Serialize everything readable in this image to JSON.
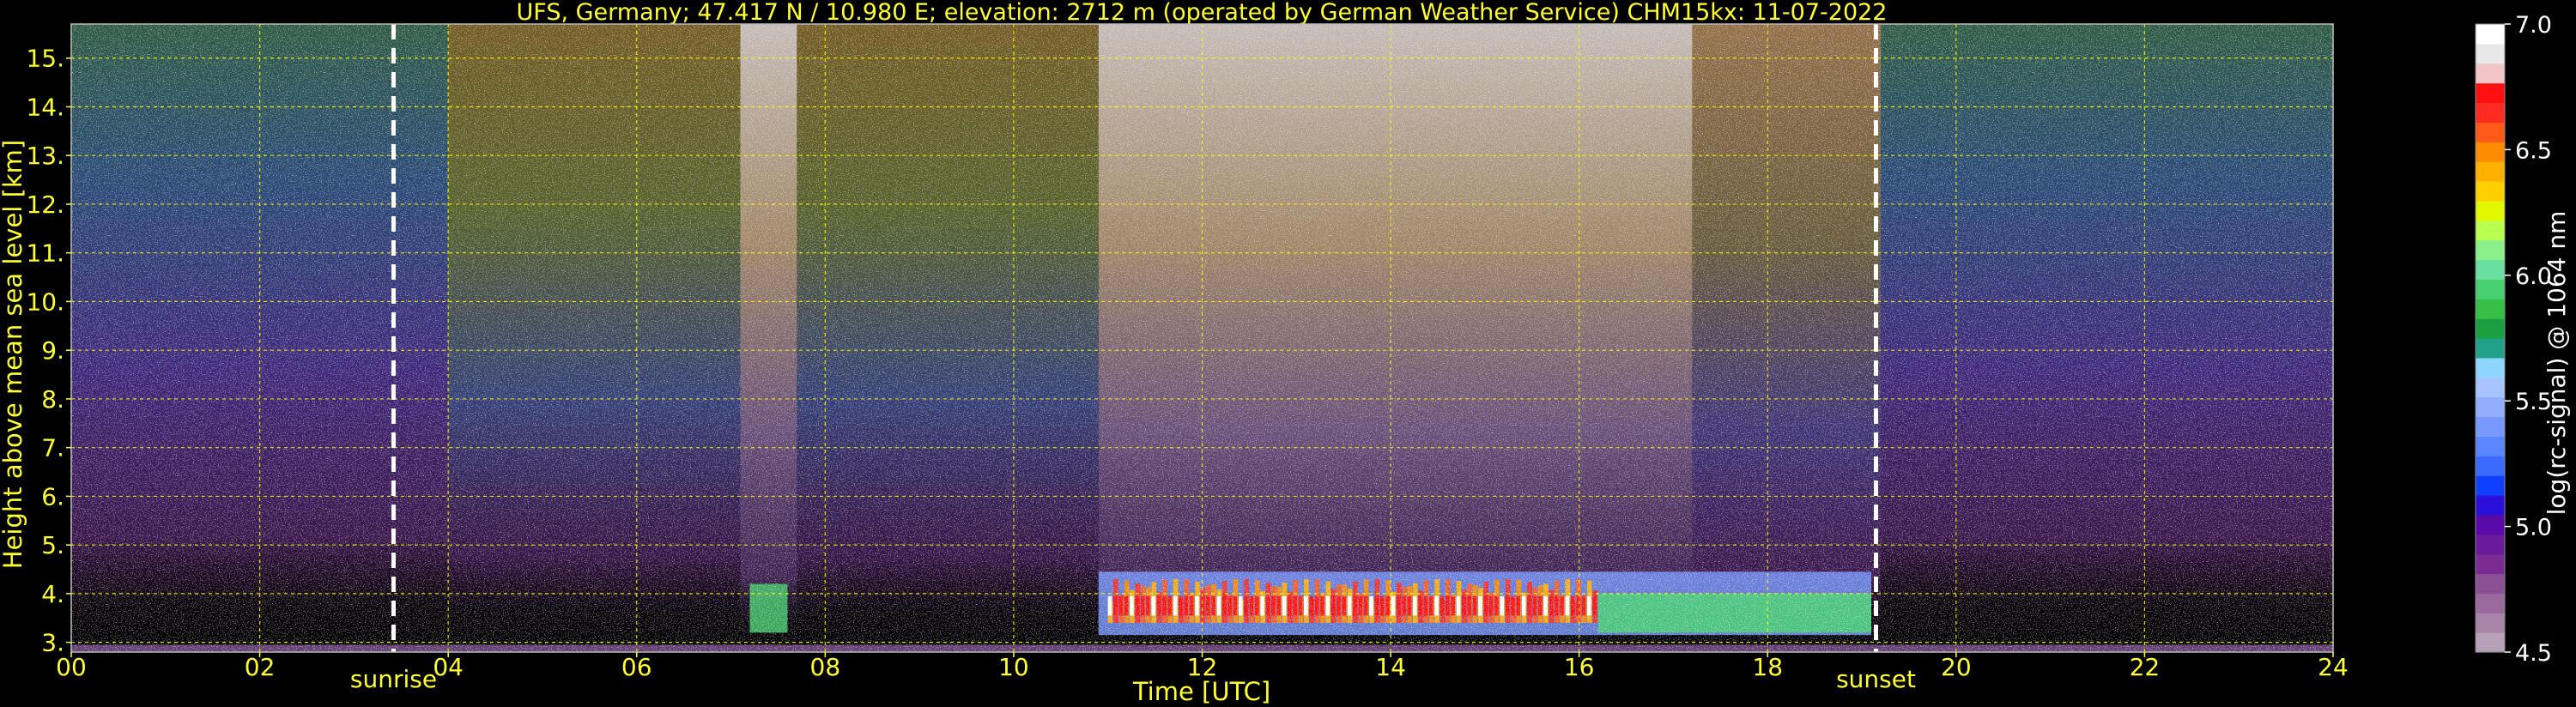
{
  "chart_data": {
    "type": "heatmap",
    "title": "UFS, Germany; 47.417 N / 10.980 E; elevation: 2712 m  (operated by German Weather Service)    CHM15kx: 11-07-2022",
    "xlabel": "Time [UTC]",
    "ylabel": "Height above mean sea level [km]",
    "xlim": [
      0,
      24
    ],
    "ylim": [
      2.8,
      15.7
    ],
    "x_ticks": [
      0,
      2,
      4,
      6,
      8,
      10,
      12,
      14,
      16,
      18,
      20,
      22,
      24
    ],
    "x_tick_labels": [
      "00",
      "02",
      "04",
      "06",
      "08",
      "10",
      "12",
      "14",
      "16",
      "18",
      "20",
      "22",
      "24"
    ],
    "y_ticks": [
      3,
      4,
      5,
      6,
      7,
      8,
      9,
      10,
      11,
      12,
      13,
      14,
      15
    ],
    "y_tick_labels": [
      "3.",
      "4.",
      "5.",
      "6.",
      "7.",
      "8.",
      "9.",
      "10.",
      "11.",
      "12.",
      "13.",
      "14.",
      "15."
    ],
    "grid": true,
    "grid_color": "#ffff00",
    "background": "#000000",
    "markers": [
      {
        "label": "sunrise",
        "x": 3.42
      },
      {
        "label": "sunset",
        "x": 19.15
      }
    ],
    "colorbar": {
      "label": "log(rc-signal) @ 1064 nm",
      "range": [
        4.5,
        7.0
      ],
      "ticks": [
        4.5,
        5.0,
        5.5,
        6.0,
        6.5,
        7.0
      ],
      "tick_labels": [
        "4.5",
        "5.0",
        "5.5",
        "6.0",
        "6.5",
        "7.0"
      ],
      "colors": [
        "#b7a1b7",
        "#a884a8",
        "#9a6a9e",
        "#8b4f95",
        "#7a2c92",
        "#6a1a9a",
        "#5a0aa8",
        "#2a10d8",
        "#1040ff",
        "#3a6aff",
        "#5a86ff",
        "#7899ff",
        "#94aeff",
        "#a8c4ff",
        "#8fd6ff",
        "#23a08a",
        "#1aa040",
        "#36c048",
        "#48d070",
        "#6ae0a0",
        "#8cf08a",
        "#b8ff50",
        "#e2f800",
        "#ffd000",
        "#ffb000",
        "#ff8c00",
        "#ff5a1a",
        "#ff2a20",
        "#ff1010",
        "#f2c6c6",
        "#e8e8e8",
        "#ffffff"
      ]
    },
    "signal_features": {
      "boundary_layer_top_km": 4.5,
      "boundary_layer_hours": [
        10.9,
        19.1
      ],
      "strong_backscatter_hours": [
        11.0,
        16.2
      ],
      "aerosol_column_hours": [
        7.2,
        7.6
      ],
      "background_noise": "high solar background between sunrise and sunset; strongest 11–17 UTC"
    }
  }
}
